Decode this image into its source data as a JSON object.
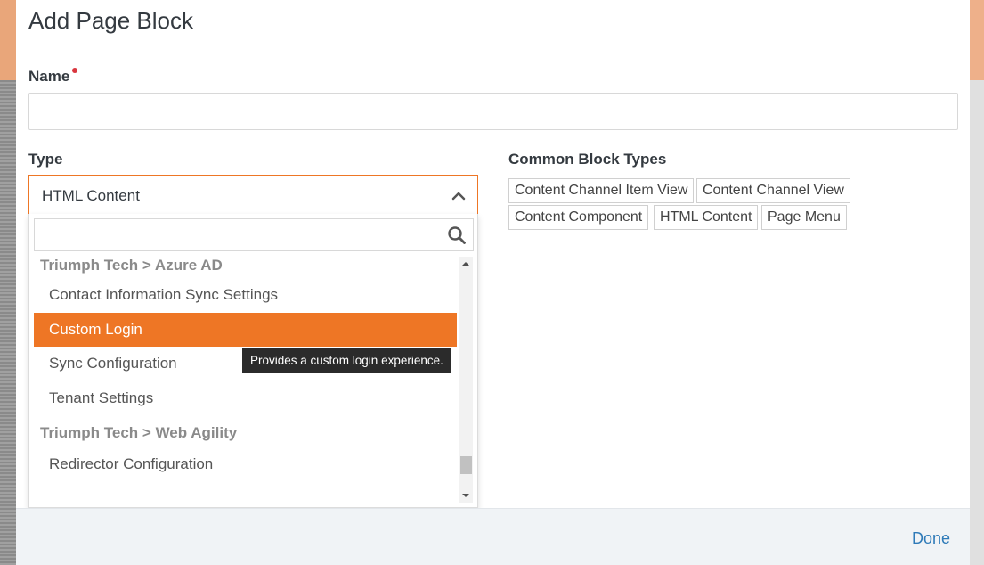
{
  "modal": {
    "title": "Add Page Block",
    "name_label": "Name",
    "name_value": "",
    "type_label": "Type",
    "common_label": "Common Block Types",
    "done_label": "Done"
  },
  "type_select": {
    "selected": "HTML Content",
    "search_value": "",
    "list": [
      {
        "kind": "group",
        "label": "Triumph Tech > Azure AD"
      },
      {
        "kind": "item",
        "label": "Contact Information Sync Settings"
      },
      {
        "kind": "item",
        "label": "Custom Login",
        "selected": true
      },
      {
        "kind": "item",
        "label": "Sync Configuration"
      },
      {
        "kind": "item",
        "label": "Tenant Settings"
      },
      {
        "kind": "group",
        "label": "Triumph Tech > Web Agility"
      },
      {
        "kind": "item",
        "label": "Redirector Configuration"
      }
    ],
    "tooltip": "Provides a custom login experience."
  },
  "common_block_types": [
    "Content Channel Item View",
    "Content Channel View",
    "Content Component",
    "HTML Content",
    "Page Menu"
  ],
  "colors": {
    "accent": "#ee7625",
    "link": "#2e7ab8",
    "required": "#d9363e"
  },
  "icons": {
    "search": "search-icon",
    "chevron": "chevron-up-icon"
  }
}
